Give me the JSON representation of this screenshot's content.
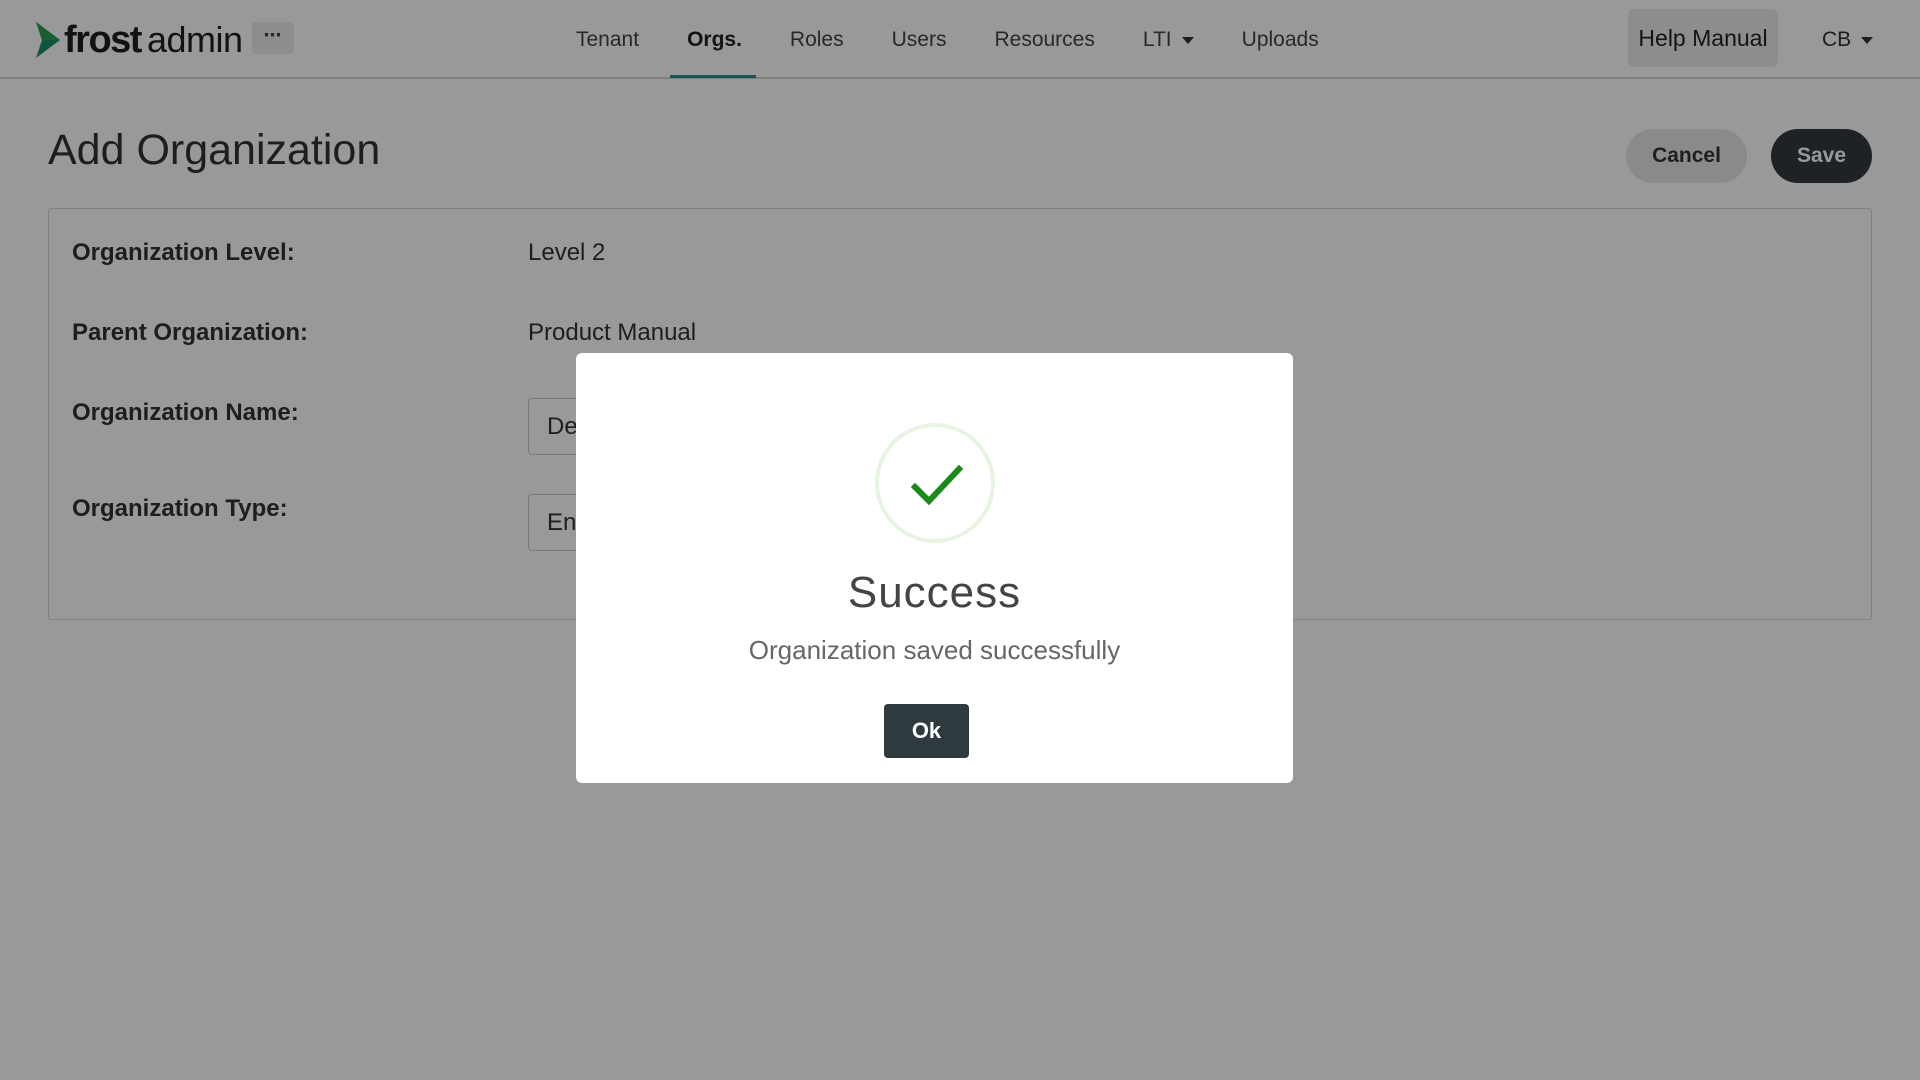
{
  "header": {
    "logo_frost": "frost",
    "logo_admin": "admin",
    "more_label": "⋯",
    "nav": [
      {
        "label": "Tenant"
      },
      {
        "label": "Orgs."
      },
      {
        "label": "Roles"
      },
      {
        "label": "Users"
      },
      {
        "label": "Resources"
      },
      {
        "label": "LTI"
      },
      {
        "label": "Uploads"
      }
    ],
    "active_nav": "Orgs.",
    "help_label": "Help Manual",
    "user_initials": "CB",
    "accent_color": "#2a8a8a",
    "logo_mark_color": "#1a8f6a"
  },
  "page": {
    "title": "Add Organization",
    "cancel_label": "Cancel",
    "save_label": "Save"
  },
  "form": {
    "level_label": "Organization Level:",
    "level_value": "Level 2",
    "parent_label": "Parent Organization:",
    "parent_value": "Product Manual",
    "name_label": "Organization Name:",
    "name_value": "De",
    "type_label": "Organization Type:",
    "type_value": "En"
  },
  "modal": {
    "title": "Success",
    "message": "Organization saved successfully",
    "ok_label": "Ok",
    "icon": "checkmark-icon",
    "icon_color": "#1a8a1a"
  }
}
